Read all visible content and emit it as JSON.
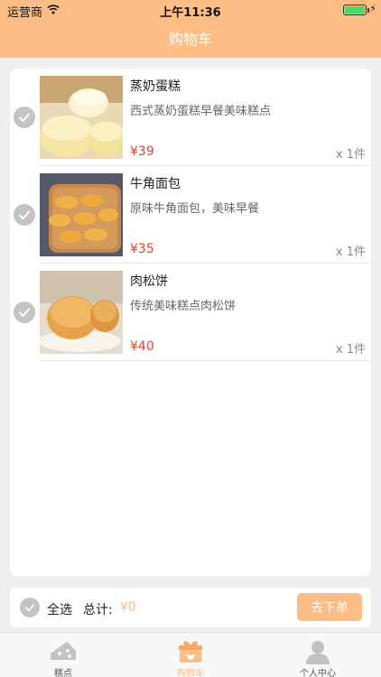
{
  "status_bar": {
    "carrier": "运营商",
    "time": "上午11:36"
  },
  "header": {
    "title": "购物车"
  },
  "cart": {
    "items": [
      {
        "name": "蒸奶蛋糕",
        "description": "西式蒸奶蛋糕早餐美味糕点",
        "price": "¥39",
        "quantity": "x 1件"
      },
      {
        "name": "牛角面包",
        "description": "原味牛角面包，美味早餐",
        "price": "¥35",
        "quantity": "x 1件"
      },
      {
        "name": "肉松饼",
        "description": "传统美味糕点肉松饼",
        "price": "¥40",
        "quantity": "x 1件"
      }
    ]
  },
  "checkout": {
    "select_all_label": "全选",
    "total_label": "总计:",
    "total_value": "¥0",
    "order_button": "去下单"
  },
  "tabbar": {
    "tabs": [
      {
        "label": "糕点",
        "icon": "cake-icon",
        "active": false
      },
      {
        "label": "购物车",
        "icon": "gift-box-icon",
        "active": true
      },
      {
        "label": "个人中心",
        "icon": "user-icon",
        "active": false
      }
    ]
  },
  "colors": {
    "accent": "#fdbd84",
    "price": "#e8412c",
    "check": "#c4c4c4"
  }
}
